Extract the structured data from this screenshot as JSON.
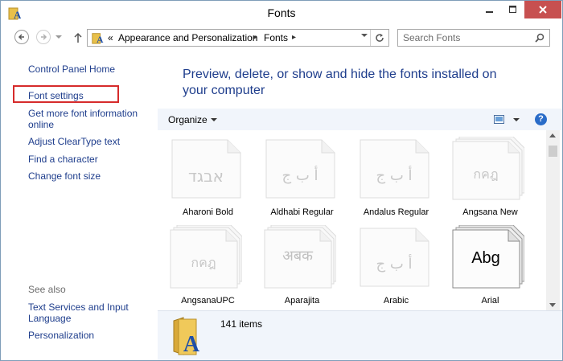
{
  "window": {
    "title": "Fonts"
  },
  "address": {
    "overflow": "«",
    "crumbs": [
      "Appearance and Personalization",
      "Fonts"
    ]
  },
  "search": {
    "placeholder": "Search Fonts"
  },
  "left_pane": {
    "links": [
      "Control Panel Home",
      "Font settings",
      "Get more font information online",
      "Adjust ClearType text",
      "Find a character",
      "Change font size"
    ],
    "selected_link": "Font settings",
    "see_also_label": "See also",
    "see_also_links": [
      "Text Services and Input Language",
      "Personalization"
    ]
  },
  "main": {
    "heading": "Preview, delete, or show and hide the fonts installed on your computer",
    "organize_label": "Organize"
  },
  "fonts": [
    {
      "name": "Aharoni Bold",
      "sample": "אבגד",
      "stacked": false,
      "faded": true
    },
    {
      "name": "Aldhabi Regular",
      "sample": "أ ب ج",
      "stacked": false,
      "faded": true
    },
    {
      "name": "Andalus Regular",
      "sample": "أ ب ج",
      "stacked": false,
      "faded": true
    },
    {
      "name": "Angsana New",
      "sample": "กคฎ",
      "stacked": true,
      "faded": true
    },
    {
      "name": "AngsanaUPC",
      "sample": "กคฎ",
      "stacked": true,
      "faded": true
    },
    {
      "name": "Aparajita",
      "sample": "अबक",
      "stacked": true,
      "faded": true
    },
    {
      "name": "Arabic",
      "sample": "أ ب ج",
      "stacked": false,
      "faded": true
    },
    {
      "name": "Arial",
      "sample": "Abg",
      "stacked": true,
      "faded": false
    }
  ],
  "details": {
    "item_count": "141 items"
  },
  "colors": {
    "link": "#1e3d8c",
    "close_button": "#c75050",
    "selection_border": "#d62b2b"
  }
}
